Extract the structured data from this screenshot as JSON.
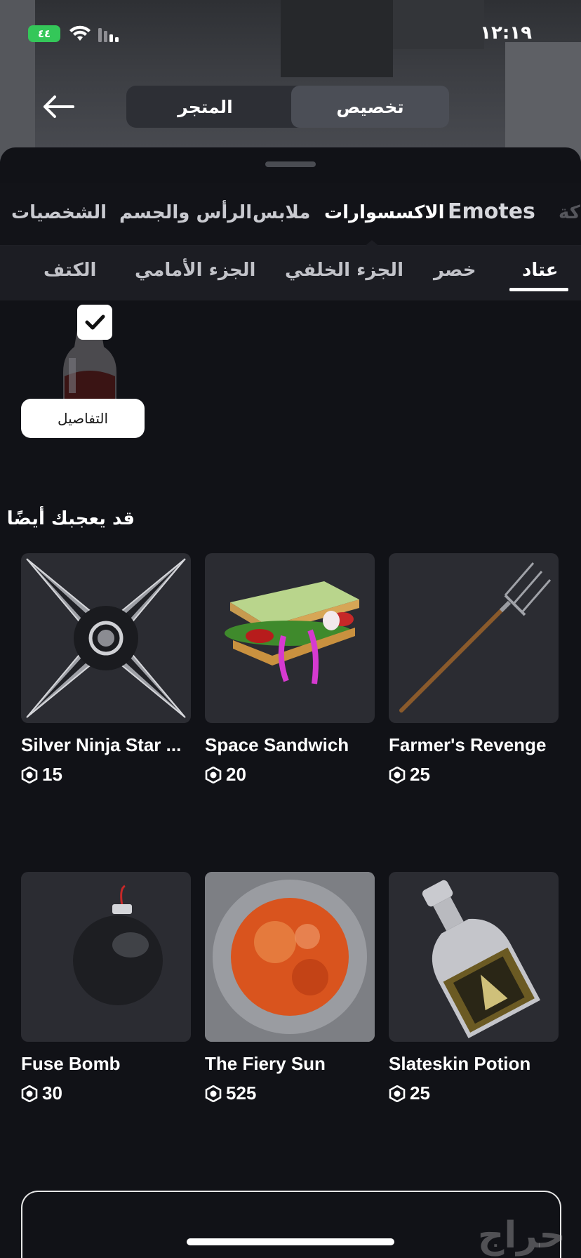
{
  "status_bar": {
    "time": "١٢:١٩",
    "battery": "٤٤"
  },
  "header": {
    "tab_store": "المتجر",
    "tab_customize": "تخصيص"
  },
  "categories": [
    {
      "label": "ﻛﺔ"
    },
    {
      "label": "Emotes"
    },
    {
      "label": "الاكسسوارات"
    },
    {
      "label": "ملابس"
    },
    {
      "label": "الرأس والجسم"
    },
    {
      "label": "الشخصيات"
    }
  ],
  "subcategories": [
    {
      "label": "عتاد"
    },
    {
      "label": "خصر"
    },
    {
      "label": "الجزء الخلفي"
    },
    {
      "label": "الجزء الأمامي"
    },
    {
      "label": "الكتف"
    }
  ],
  "equipped": {
    "details_label": "التفاصيل"
  },
  "recommendations": {
    "title": "قد يعجبك أيضًا",
    "items": [
      {
        "name": "Silver Ninja Star ...",
        "price": "15"
      },
      {
        "name": "Space Sandwich",
        "price": "20"
      },
      {
        "name": "Farmer's Revenge",
        "price": "25"
      },
      {
        "name": "Fuse Bomb",
        "price": "30"
      },
      {
        "name": "The Fiery Sun",
        "price": "525"
      },
      {
        "name": "Slateskin Potion",
        "price": "25"
      }
    ]
  },
  "watermark": "حراج"
}
